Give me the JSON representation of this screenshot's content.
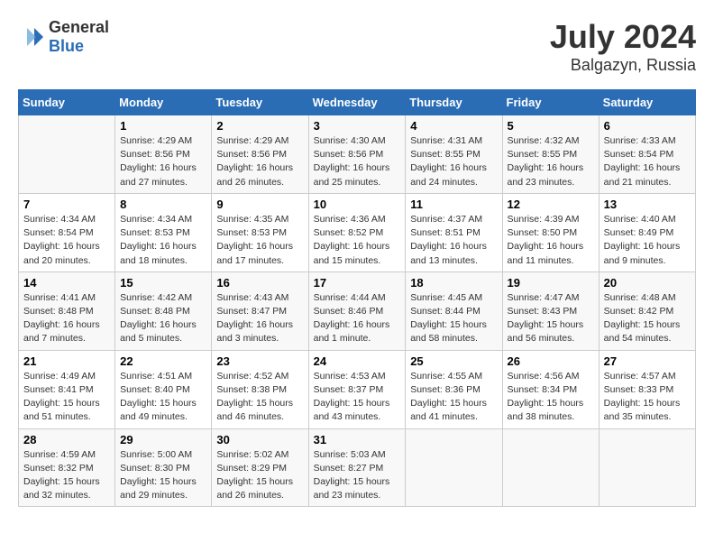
{
  "header": {
    "logo": {
      "general": "General",
      "blue": "Blue"
    },
    "title": "July 2024",
    "subtitle": "Balgazyn, Russia"
  },
  "days_of_week": [
    "Sunday",
    "Monday",
    "Tuesday",
    "Wednesday",
    "Thursday",
    "Friday",
    "Saturday"
  ],
  "weeks": [
    [
      {
        "day": "",
        "sunrise": "",
        "sunset": "",
        "daylight": ""
      },
      {
        "day": "1",
        "sunrise": "Sunrise: 4:29 AM",
        "sunset": "Sunset: 8:56 PM",
        "daylight": "Daylight: 16 hours and 27 minutes."
      },
      {
        "day": "2",
        "sunrise": "Sunrise: 4:29 AM",
        "sunset": "Sunset: 8:56 PM",
        "daylight": "Daylight: 16 hours and 26 minutes."
      },
      {
        "day": "3",
        "sunrise": "Sunrise: 4:30 AM",
        "sunset": "Sunset: 8:56 PM",
        "daylight": "Daylight: 16 hours and 25 minutes."
      },
      {
        "day": "4",
        "sunrise": "Sunrise: 4:31 AM",
        "sunset": "Sunset: 8:55 PM",
        "daylight": "Daylight: 16 hours and 24 minutes."
      },
      {
        "day": "5",
        "sunrise": "Sunrise: 4:32 AM",
        "sunset": "Sunset: 8:55 PM",
        "daylight": "Daylight: 16 hours and 23 minutes."
      },
      {
        "day": "6",
        "sunrise": "Sunrise: 4:33 AM",
        "sunset": "Sunset: 8:54 PM",
        "daylight": "Daylight: 16 hours and 21 minutes."
      }
    ],
    [
      {
        "day": "7",
        "sunrise": "Sunrise: 4:34 AM",
        "sunset": "Sunset: 8:54 PM",
        "daylight": "Daylight: 16 hours and 20 minutes."
      },
      {
        "day": "8",
        "sunrise": "Sunrise: 4:34 AM",
        "sunset": "Sunset: 8:53 PM",
        "daylight": "Daylight: 16 hours and 18 minutes."
      },
      {
        "day": "9",
        "sunrise": "Sunrise: 4:35 AM",
        "sunset": "Sunset: 8:53 PM",
        "daylight": "Daylight: 16 hours and 17 minutes."
      },
      {
        "day": "10",
        "sunrise": "Sunrise: 4:36 AM",
        "sunset": "Sunset: 8:52 PM",
        "daylight": "Daylight: 16 hours and 15 minutes."
      },
      {
        "day": "11",
        "sunrise": "Sunrise: 4:37 AM",
        "sunset": "Sunset: 8:51 PM",
        "daylight": "Daylight: 16 hours and 13 minutes."
      },
      {
        "day": "12",
        "sunrise": "Sunrise: 4:39 AM",
        "sunset": "Sunset: 8:50 PM",
        "daylight": "Daylight: 16 hours and 11 minutes."
      },
      {
        "day": "13",
        "sunrise": "Sunrise: 4:40 AM",
        "sunset": "Sunset: 8:49 PM",
        "daylight": "Daylight: 16 hours and 9 minutes."
      }
    ],
    [
      {
        "day": "14",
        "sunrise": "Sunrise: 4:41 AM",
        "sunset": "Sunset: 8:48 PM",
        "daylight": "Daylight: 16 hours and 7 minutes."
      },
      {
        "day": "15",
        "sunrise": "Sunrise: 4:42 AM",
        "sunset": "Sunset: 8:48 PM",
        "daylight": "Daylight: 16 hours and 5 minutes."
      },
      {
        "day": "16",
        "sunrise": "Sunrise: 4:43 AM",
        "sunset": "Sunset: 8:47 PM",
        "daylight": "Daylight: 16 hours and 3 minutes."
      },
      {
        "day": "17",
        "sunrise": "Sunrise: 4:44 AM",
        "sunset": "Sunset: 8:46 PM",
        "daylight": "Daylight: 16 hours and 1 minute."
      },
      {
        "day": "18",
        "sunrise": "Sunrise: 4:45 AM",
        "sunset": "Sunset: 8:44 PM",
        "daylight": "Daylight: 15 hours and 58 minutes."
      },
      {
        "day": "19",
        "sunrise": "Sunrise: 4:47 AM",
        "sunset": "Sunset: 8:43 PM",
        "daylight": "Daylight: 15 hours and 56 minutes."
      },
      {
        "day": "20",
        "sunrise": "Sunrise: 4:48 AM",
        "sunset": "Sunset: 8:42 PM",
        "daylight": "Daylight: 15 hours and 54 minutes."
      }
    ],
    [
      {
        "day": "21",
        "sunrise": "Sunrise: 4:49 AM",
        "sunset": "Sunset: 8:41 PM",
        "daylight": "Daylight: 15 hours and 51 minutes."
      },
      {
        "day": "22",
        "sunrise": "Sunrise: 4:51 AM",
        "sunset": "Sunset: 8:40 PM",
        "daylight": "Daylight: 15 hours and 49 minutes."
      },
      {
        "day": "23",
        "sunrise": "Sunrise: 4:52 AM",
        "sunset": "Sunset: 8:38 PM",
        "daylight": "Daylight: 15 hours and 46 minutes."
      },
      {
        "day": "24",
        "sunrise": "Sunrise: 4:53 AM",
        "sunset": "Sunset: 8:37 PM",
        "daylight": "Daylight: 15 hours and 43 minutes."
      },
      {
        "day": "25",
        "sunrise": "Sunrise: 4:55 AM",
        "sunset": "Sunset: 8:36 PM",
        "daylight": "Daylight: 15 hours and 41 minutes."
      },
      {
        "day": "26",
        "sunrise": "Sunrise: 4:56 AM",
        "sunset": "Sunset: 8:34 PM",
        "daylight": "Daylight: 15 hours and 38 minutes."
      },
      {
        "day": "27",
        "sunrise": "Sunrise: 4:57 AM",
        "sunset": "Sunset: 8:33 PM",
        "daylight": "Daylight: 15 hours and 35 minutes."
      }
    ],
    [
      {
        "day": "28",
        "sunrise": "Sunrise: 4:59 AM",
        "sunset": "Sunset: 8:32 PM",
        "daylight": "Daylight: 15 hours and 32 minutes."
      },
      {
        "day": "29",
        "sunrise": "Sunrise: 5:00 AM",
        "sunset": "Sunset: 8:30 PM",
        "daylight": "Daylight: 15 hours and 29 minutes."
      },
      {
        "day": "30",
        "sunrise": "Sunrise: 5:02 AM",
        "sunset": "Sunset: 8:29 PM",
        "daylight": "Daylight: 15 hours and 26 minutes."
      },
      {
        "day": "31",
        "sunrise": "Sunrise: 5:03 AM",
        "sunset": "Sunset: 8:27 PM",
        "daylight": "Daylight: 15 hours and 23 minutes."
      },
      {
        "day": "",
        "sunrise": "",
        "sunset": "",
        "daylight": ""
      },
      {
        "day": "",
        "sunrise": "",
        "sunset": "",
        "daylight": ""
      },
      {
        "day": "",
        "sunrise": "",
        "sunset": "",
        "daylight": ""
      }
    ]
  ]
}
